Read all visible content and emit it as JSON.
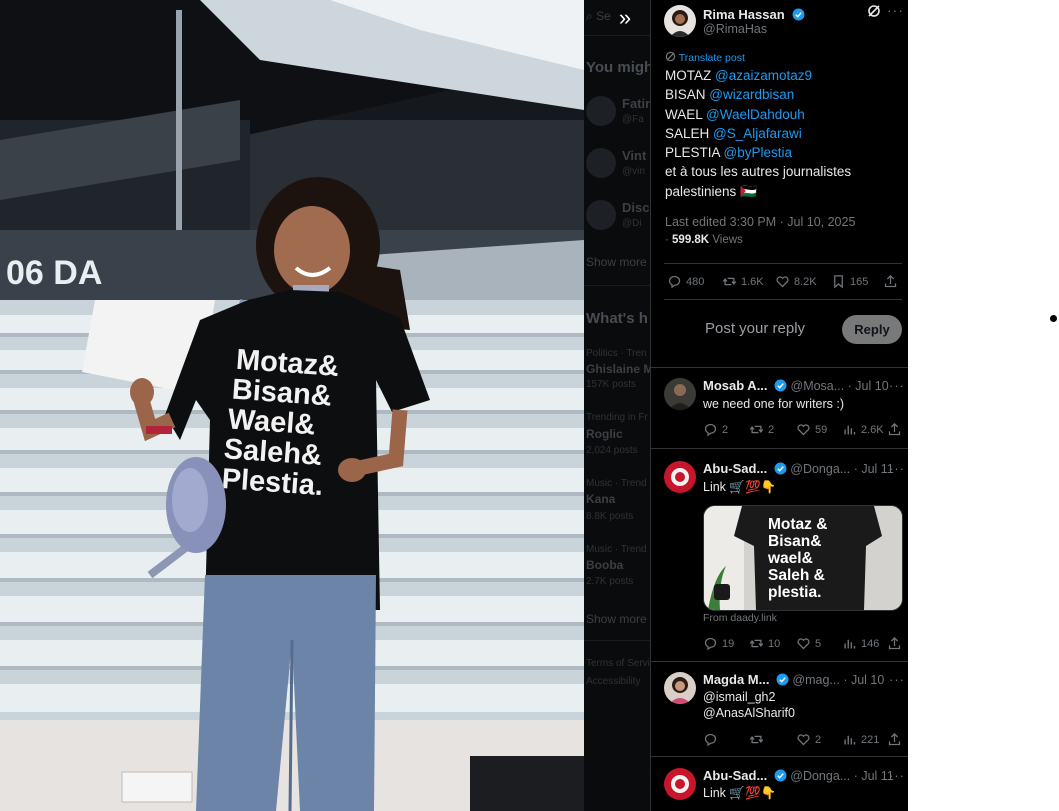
{
  "photo": {
    "shirt_lines": [
      "Motaz&",
      "Bisan&",
      "Wael&",
      "Saleh&",
      "Plestia."
    ],
    "wall_text": "06 DA"
  },
  "background_sidebar": {
    "search_fragment": "Se",
    "you_might_heading": "You migh",
    "suggestions": [
      {
        "name": "Fatin",
        "handle": "@Fa"
      },
      {
        "name": "Vint",
        "handle": "@vin"
      },
      {
        "name": "Disco",
        "handle": "@Di"
      }
    ],
    "show_more_1": "Show more",
    "whats_heading": "What's h",
    "trends": [
      {
        "meta": "Politics · Tren",
        "topic": "Ghislaine M",
        "posts": "157K posts"
      },
      {
        "meta": "Trending in Fr",
        "topic": "Roglic",
        "posts": "2,024 posts"
      },
      {
        "meta": "Music · Trend",
        "topic": "Kana",
        "posts": "8.8K posts"
      },
      {
        "meta": "Music · Trend",
        "topic": "Booba",
        "posts": "2.7K posts"
      }
    ],
    "show_more_2": "Show more",
    "footer_1": "Terms of Servic",
    "footer_2": "Accessibility"
  },
  "post": {
    "author_name": "Rima Hassan",
    "author_handle": "@RimaHas",
    "translate_label": "Translate post",
    "lines": [
      {
        "label": "MOTAZ ",
        "mention": "@azaizamotaz9"
      },
      {
        "label": "BISAN ",
        "mention": "@wizardbisan"
      },
      {
        "label": "WAEL ",
        "mention": "@WaelDahdouh"
      },
      {
        "label": "SALEH ",
        "mention": "@S_Aljafarawi"
      },
      {
        "label": "PLESTIA ",
        "mention": "@byPlestia"
      }
    ],
    "closing_line_1": "et à tous les autres journalistes",
    "closing_line_2": "palestiniens 🇵🇸",
    "edited": "Last edited 3:30 PM · Jul 10, 2025",
    "views_prefix": " · ",
    "views_count": "599.8K",
    "views_label": " Views",
    "stats": {
      "replies": "480",
      "reposts": "1.6K",
      "likes": "8.2K",
      "bookmarks": "165"
    }
  },
  "reply_box": {
    "placeholder": "Post your reply",
    "button": "Reply"
  },
  "replies": [
    {
      "name": "Mosab A...",
      "handle": "@Mosa...",
      "date": "· Jul 10",
      "text": "we need one for writers :)",
      "replies": "2",
      "reposts": "2",
      "likes": "59",
      "views": "2.6K"
    },
    {
      "name": "Abu-Sad...",
      "handle": "@Donga...",
      "date": "· Jul 11",
      "text": "Link 🛒💯👇",
      "card_lines": [
        "Motaz &",
        "Bisan&",
        "wael&",
        "Saleh &",
        "plestia."
      ],
      "card_source": "From daady.link",
      "replies": "19",
      "reposts": "10",
      "likes": "5",
      "views": "146"
    },
    {
      "name": "Magda M...",
      "handle": "@mag...",
      "date": "· Jul 10",
      "mention_1": "@ismail_gh2",
      "mention_2": "@AnasAlSharif0",
      "replies": "",
      "reposts": "",
      "likes": "2",
      "views": "221"
    },
    {
      "name": "Abu-Sad...",
      "handle": "@Donga...",
      "date": "· Jul 11",
      "text": "Link 🛒💯👇"
    }
  ],
  "colors": {
    "accent": "#1d9bf0",
    "panel_bg": "#000000",
    "muted": "#71767b"
  }
}
